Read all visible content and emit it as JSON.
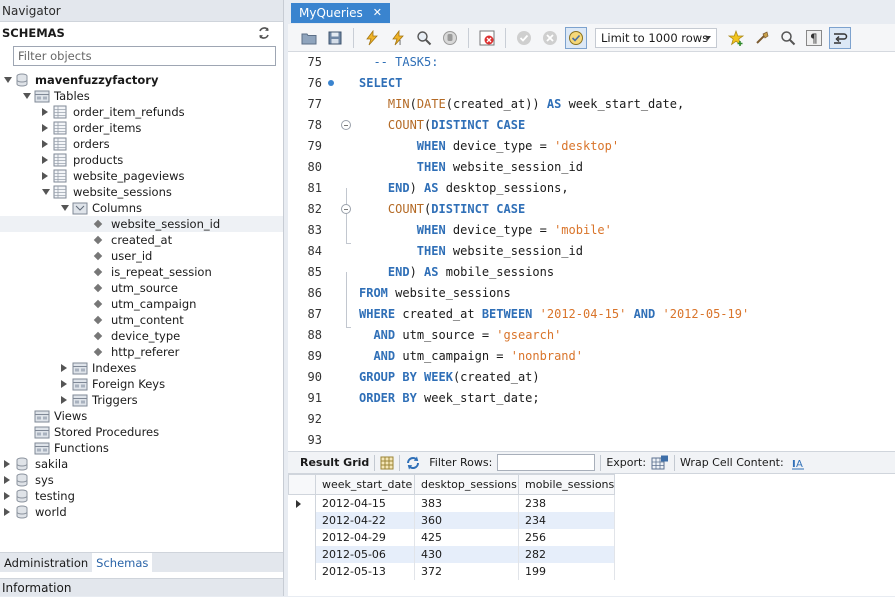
{
  "navigator": {
    "title": "Navigator",
    "schemas_label": "SCHEMAS",
    "filter_placeholder": "Filter objects",
    "tree": [
      {
        "label": "mavenfuzzyfactory",
        "bold": true,
        "level": 0,
        "toggle": "open",
        "icon": "database"
      },
      {
        "label": "Tables",
        "level": 1,
        "toggle": "open",
        "icon": "folder"
      },
      {
        "label": "order_item_refunds",
        "level": 2,
        "toggle": "closed",
        "icon": "table"
      },
      {
        "label": "order_items",
        "level": 2,
        "toggle": "closed",
        "icon": "table"
      },
      {
        "label": "orders",
        "level": 2,
        "toggle": "closed",
        "icon": "table"
      },
      {
        "label": "products",
        "level": 2,
        "toggle": "closed",
        "icon": "table"
      },
      {
        "label": "website_pageviews",
        "level": 2,
        "toggle": "closed",
        "icon": "table"
      },
      {
        "label": "website_sessions",
        "level": 2,
        "toggle": "open",
        "icon": "table"
      },
      {
        "label": "Columns",
        "level": 3,
        "toggle": "open",
        "icon": "columns"
      },
      {
        "label": "website_session_id",
        "level": 4,
        "toggle": "none",
        "icon": "column",
        "selected": true
      },
      {
        "label": "created_at",
        "level": 4,
        "toggle": "none",
        "icon": "column"
      },
      {
        "label": "user_id",
        "level": 4,
        "toggle": "none",
        "icon": "column"
      },
      {
        "label": "is_repeat_session",
        "level": 4,
        "toggle": "none",
        "icon": "column"
      },
      {
        "label": "utm_source",
        "level": 4,
        "toggle": "none",
        "icon": "column"
      },
      {
        "label": "utm_campaign",
        "level": 4,
        "toggle": "none",
        "icon": "column"
      },
      {
        "label": "utm_content",
        "level": 4,
        "toggle": "none",
        "icon": "column"
      },
      {
        "label": "device_type",
        "level": 4,
        "toggle": "none",
        "icon": "column"
      },
      {
        "label": "http_referer",
        "level": 4,
        "toggle": "none",
        "icon": "column"
      },
      {
        "label": "Indexes",
        "level": 3,
        "toggle": "closed",
        "icon": "folder"
      },
      {
        "label": "Foreign Keys",
        "level": 3,
        "toggle": "closed",
        "icon": "folder"
      },
      {
        "label": "Triggers",
        "level": 3,
        "toggle": "closed",
        "icon": "folder"
      },
      {
        "label": "Views",
        "level": 1,
        "toggle": "none",
        "icon": "folder"
      },
      {
        "label": "Stored Procedures",
        "level": 1,
        "toggle": "none",
        "icon": "folder"
      },
      {
        "label": "Functions",
        "level": 1,
        "toggle": "none",
        "icon": "folder"
      },
      {
        "label": "sakila",
        "level": 0,
        "toggle": "closed",
        "icon": "database"
      },
      {
        "label": "sys",
        "level": 0,
        "toggle": "closed",
        "icon": "database"
      },
      {
        "label": "testing",
        "level": 0,
        "toggle": "closed",
        "icon": "database"
      },
      {
        "label": "world",
        "level": 0,
        "toggle": "closed",
        "icon": "database"
      }
    ],
    "bottom_tabs": {
      "administration": "Administration",
      "schemas": "Schemas"
    },
    "information_label": "Information"
  },
  "editor": {
    "tab_label": "MyQueries",
    "tab_close": "✕",
    "limit_rows": "Limit to 1000 rows",
    "lines": [
      {
        "n": "75",
        "tokens": [
          [
            "cm",
            "  -- TASK5:"
          ]
        ]
      },
      {
        "n": "76",
        "bp": true,
        "tokens": [
          [
            "kw",
            "SELECT"
          ]
        ]
      },
      {
        "n": "77",
        "tokens": [
          [
            "",
            "    "
          ],
          [
            "fn",
            "MIN"
          ],
          [
            "",
            "("
          ],
          [
            "fn",
            "DATE"
          ],
          [
            "",
            "(created_at)) "
          ],
          [
            "kw",
            "AS"
          ],
          [
            "",
            " week_start_date,"
          ]
        ]
      },
      {
        "n": "78",
        "fold": true,
        "tokens": [
          [
            "",
            "    "
          ],
          [
            "fn",
            "COUNT"
          ],
          [
            "",
            "("
          ],
          [
            "kw",
            "DISTINCT CASE"
          ]
        ]
      },
      {
        "n": "79",
        "tokens": [
          [
            "",
            "        "
          ],
          [
            "kw",
            "WHEN"
          ],
          [
            "",
            " device_type = "
          ],
          [
            "str",
            "'desktop'"
          ]
        ]
      },
      {
        "n": "80",
        "tokens": [
          [
            "",
            "        "
          ],
          [
            "kw",
            "THEN"
          ],
          [
            "",
            " website_session_id"
          ]
        ]
      },
      {
        "n": "81",
        "tokens": [
          [
            "",
            "    "
          ],
          [
            "kw",
            "END"
          ],
          [
            "",
            ") "
          ],
          [
            "kw",
            "AS"
          ],
          [
            "",
            " desktop_sessions,"
          ]
        ]
      },
      {
        "n": "82",
        "fold": true,
        "tokens": [
          [
            "",
            "    "
          ],
          [
            "fn",
            "COUNT"
          ],
          [
            "",
            "("
          ],
          [
            "kw",
            "DISTINCT CASE"
          ]
        ]
      },
      {
        "n": "83",
        "tokens": [
          [
            "",
            "        "
          ],
          [
            "kw",
            "WHEN"
          ],
          [
            "",
            " device_type = "
          ],
          [
            "str",
            "'mobile'"
          ]
        ]
      },
      {
        "n": "84",
        "tokens": [
          [
            "",
            "        "
          ],
          [
            "kw",
            "THEN"
          ],
          [
            "",
            " website_session_id"
          ]
        ]
      },
      {
        "n": "85",
        "tokens": [
          [
            "",
            "    "
          ],
          [
            "kw",
            "END"
          ],
          [
            "",
            ") "
          ],
          [
            "kw",
            "AS"
          ],
          [
            "",
            " mobile_sessions"
          ]
        ]
      },
      {
        "n": "86",
        "tokens": [
          [
            "kw",
            "FROM"
          ],
          [
            "",
            " website_sessions"
          ]
        ]
      },
      {
        "n": "87",
        "tokens": [
          [
            "kw",
            "WHERE"
          ],
          [
            "",
            " created_at "
          ],
          [
            "kw",
            "BETWEEN"
          ],
          [
            "",
            " "
          ],
          [
            "str",
            "'2012-04-15'"
          ],
          [
            "",
            " "
          ],
          [
            "kw",
            "AND"
          ],
          [
            "",
            " "
          ],
          [
            "str",
            "'2012-05-19'"
          ]
        ]
      },
      {
        "n": "88",
        "tokens": [
          [
            "",
            "  "
          ],
          [
            "kw",
            "AND"
          ],
          [
            "",
            " utm_source = "
          ],
          [
            "str",
            "'gsearch'"
          ]
        ]
      },
      {
        "n": "89",
        "tokens": [
          [
            "",
            "  "
          ],
          [
            "kw",
            "AND"
          ],
          [
            "",
            " utm_campaign = "
          ],
          [
            "str",
            "'nonbrand'"
          ]
        ]
      },
      {
        "n": "90",
        "tokens": [
          [
            "kw",
            "GROUP BY"
          ],
          [
            "",
            " "
          ],
          [
            "kw",
            "WEEK"
          ],
          [
            "",
            "(created_at)"
          ]
        ]
      },
      {
        "n": "91",
        "tokens": [
          [
            "kw",
            "ORDER BY"
          ],
          [
            "",
            " week_start_date;"
          ]
        ]
      },
      {
        "n": "92",
        "tokens": []
      },
      {
        "n": "93",
        "tokens": []
      }
    ]
  },
  "results": {
    "result_grid_label": "Result Grid",
    "filter_rows_label": "Filter Rows:",
    "export_label": "Export:",
    "wrap_label": "Wrap Cell Content:",
    "columns": [
      "week_start_date",
      "desktop_sessions",
      "mobile_sessions"
    ],
    "rows": [
      [
        "2012-04-15",
        "383",
        "238"
      ],
      [
        "2012-04-22",
        "360",
        "234"
      ],
      [
        "2012-04-29",
        "425",
        "256"
      ],
      [
        "2012-05-06",
        "430",
        "282"
      ],
      [
        "2012-05-13",
        "372",
        "199"
      ]
    ]
  },
  "colors": {
    "accent": "#3a84cf",
    "keyword": "#2f6fb7",
    "string": "#d9742a",
    "function": "#b46a25",
    "alt_row": "#e6eefa"
  }
}
